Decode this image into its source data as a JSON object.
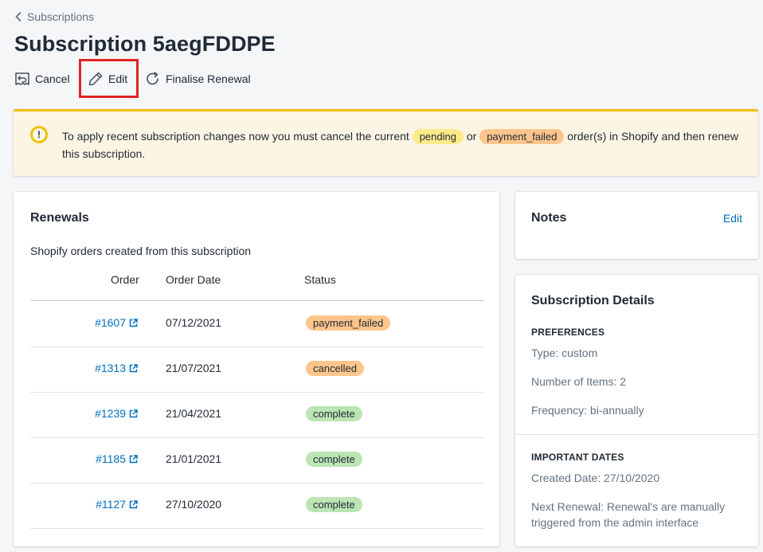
{
  "breadcrumb": {
    "label": "Subscriptions"
  },
  "page": {
    "title": "Subscription 5aegFDDPE"
  },
  "actions": {
    "cancel_label": "Cancel",
    "edit_label": "Edit",
    "finalise_label": "Finalise Renewal"
  },
  "banner": {
    "text_before": "To apply recent subscription changes now you must cancel the current",
    "pill_pending": "pending",
    "text_or": "or",
    "pill_payment_failed": "payment_failed",
    "text_after": "order(s) in Shopify and then renew this subscription."
  },
  "renewals": {
    "title": "Renewals",
    "subtitle": "Shopify orders created from this subscription",
    "columns": {
      "order": "Order",
      "order_date": "Order Date",
      "status": "Status"
    },
    "rows": [
      {
        "order": "#1607",
        "date": "07/12/2021",
        "status": "payment_failed",
        "status_color": "#ffc58b"
      },
      {
        "order": "#1313",
        "date": "21/07/2021",
        "status": "cancelled",
        "status_color": "#ffc58b"
      },
      {
        "order": "#1239",
        "date": "21/04/2021",
        "status": "complete",
        "status_color": "#bbe5b3"
      },
      {
        "order": "#1185",
        "date": "21/01/2021",
        "status": "complete",
        "status_color": "#bbe5b3"
      },
      {
        "order": "#1127",
        "date": "27/10/2020",
        "status": "complete",
        "status_color": "#bbe5b3"
      }
    ]
  },
  "notes": {
    "title": "Notes",
    "edit_label": "Edit"
  },
  "details": {
    "title": "Subscription Details",
    "preferences_heading": "PREFERENCES",
    "type": "Type: custom",
    "items": "Number of Items: 2",
    "frequency": "Frequency: bi-annually",
    "dates_heading": "IMPORTANT DATES",
    "created": "Created Date: 27/10/2020",
    "next_renewal": "Next Renewal: Renewal's are manually triggered from the admin interface"
  },
  "colors": {
    "link": "#006fbb",
    "banner_bg": "#fdf5e4",
    "banner_accent": "#eec200",
    "highlight": "#e02424"
  }
}
